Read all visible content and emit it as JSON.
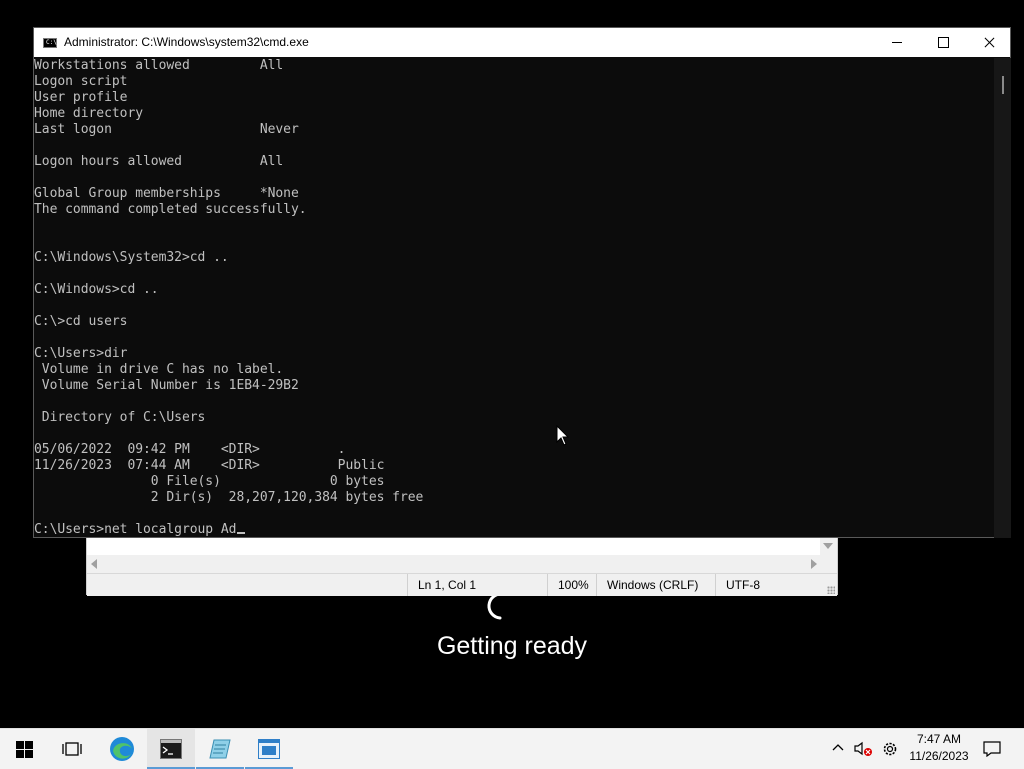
{
  "cmd": {
    "title": "Administrator: C:\\Windows\\system32\\cmd.exe",
    "icon_text": "C:\\",
    "lines": [
      "Workstations allowed         All",
      "Logon script",
      "User profile",
      "Home directory",
      "Last logon                   Never",
      "",
      "Logon hours allowed          All",
      "",
      "Global Group memberships     *None",
      "The command completed successfully.",
      "",
      "",
      "C:\\Windows\\System32>cd ..",
      "",
      "C:\\Windows>cd ..",
      "",
      "C:\\>cd users",
      "",
      "C:\\Users>dir",
      " Volume in drive C has no label.",
      " Volume Serial Number is 1EB4-29B2",
      "",
      " Directory of C:\\Users",
      "",
      "05/06/2022  09:42 PM    <DIR>          .",
      "11/26/2023  07:44 AM    <DIR>          Public",
      "               0 File(s)              0 bytes",
      "               2 Dir(s)  28,207,120,384 bytes free",
      "",
      "C:\\Users>net localgroup Ad"
    ]
  },
  "notepad": {
    "status": {
      "position": "Ln 1, Col 1",
      "zoom": "100%",
      "line_ending": "Windows (CRLF)",
      "encoding": "UTF-8"
    }
  },
  "overlay": {
    "message": "Getting ready"
  },
  "taskbar": {
    "time": "7:47 AM",
    "date": "11/26/2023",
    "items": [
      "start-button",
      "task-view-icon",
      "edge-icon",
      "cmd-taskbar-icon",
      "notepad-like-icon",
      "app-window-icon"
    ],
    "accent": "#5b9bd5"
  }
}
